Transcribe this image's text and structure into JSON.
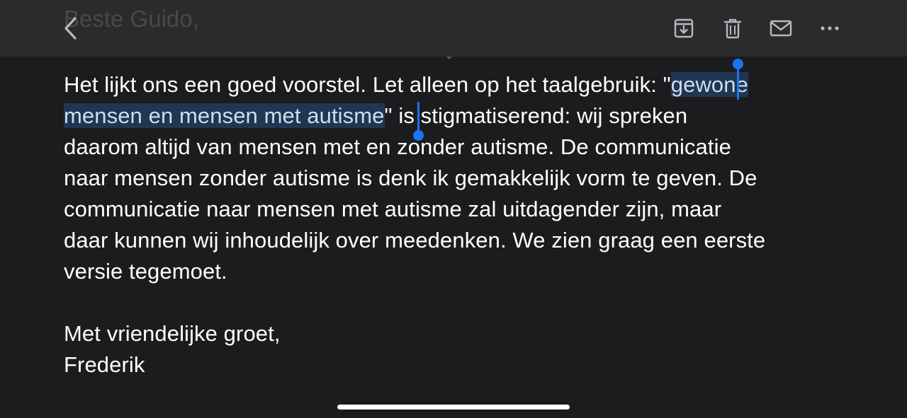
{
  "header": {
    "greeting_ghost": "Beste Guido,",
    "icons": {
      "back": "chevron-left-icon",
      "archive": "archive-tray-icon",
      "trash": "trash-icon",
      "mail": "envelope-icon",
      "more": "ellipsis-icon"
    }
  },
  "message": {
    "lines": [
      {
        "before": "Het lijkt ons een goed voorstel. Let alleen op het taalgebruik: \"",
        "selected": "gewone"
      },
      {
        "selected": "mensen en mensen met autisme",
        "after": "\" is stigmatiserend: wij spreken"
      },
      {
        "text": "daarom altijd van mensen met en zonder autisme. De communicatie"
      },
      {
        "text": "naar mensen zonder autisme is denk ik gemakkelijk vorm te geven. De"
      },
      {
        "text": "communicatie naar mensen met autisme zal uitdagender zijn, maar"
      },
      {
        "text": "daar kunnen wij inhoudelijk over meedenken. We zien graag een eerste"
      },
      {
        "text": "versie tegemoet."
      }
    ],
    "closing": "Met vriendelijke groet,",
    "signature": "Frederik"
  },
  "colors": {
    "background": "#1c1c1e",
    "toolbar": "#2b2b2d",
    "selection": "#1f3752",
    "selection_handle": "#1976f2"
  }
}
